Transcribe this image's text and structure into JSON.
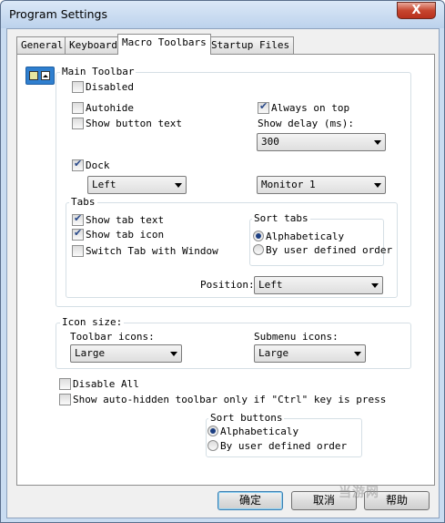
{
  "window": {
    "title": "Program Settings",
    "close_glyph": "X"
  },
  "tabs": [
    {
      "label": "General"
    },
    {
      "label": "Keyboard"
    },
    {
      "label": "Macro Toolbars"
    },
    {
      "label": "Startup Files"
    }
  ],
  "main_toolbar": {
    "group_title": "Main Toolbar",
    "disabled": {
      "label": "Disabled",
      "checked": false
    },
    "autohide": {
      "label": "Autohide",
      "checked": false
    },
    "show_button_text": {
      "label": "Show button text",
      "checked": false
    },
    "always_on_top": {
      "label": "Always on top",
      "checked": true
    },
    "show_delay_label": "Show delay (ms):",
    "show_delay_value": "300",
    "dock": {
      "label": "Dock",
      "checked": true
    },
    "dock_side_value": "Left",
    "monitor_value": "Monitor 1",
    "tabs_group": {
      "title": "Tabs",
      "show_tab_text": {
        "label": "Show tab text",
        "checked": true
      },
      "show_tab_icon": {
        "label": "Show tab icon",
        "checked": true
      },
      "switch_tab_with_window": {
        "label": "Switch Tab with Window",
        "checked": false
      },
      "sort_tabs_title": "Sort tabs",
      "sort_alpha": {
        "label": "Alphabeticaly",
        "selected": true
      },
      "sort_user": {
        "label": "By user defined order",
        "selected": false
      },
      "position_label": "Position:",
      "position_value": "Left"
    }
  },
  "icon_size": {
    "title": "Icon size:",
    "toolbar_icons_label": "Toolbar icons:",
    "toolbar_icons_value": "Large",
    "submenu_icons_label": "Submenu icons:",
    "submenu_icons_value": "Large"
  },
  "disable_all": {
    "label": "Disable All",
    "checked": false
  },
  "show_auto_hidden": {
    "label": "Show auto-hidden toolbar only if \"Ctrl\" key is press",
    "checked": false
  },
  "sort_buttons": {
    "title": "Sort buttons",
    "alpha": {
      "label": "Alphabeticaly",
      "selected": true
    },
    "user": {
      "label": "By user defined order",
      "selected": false
    }
  },
  "buttons": {
    "ok": "确定",
    "cancel": "取消",
    "help": "帮助"
  },
  "watermark": "当游网"
}
